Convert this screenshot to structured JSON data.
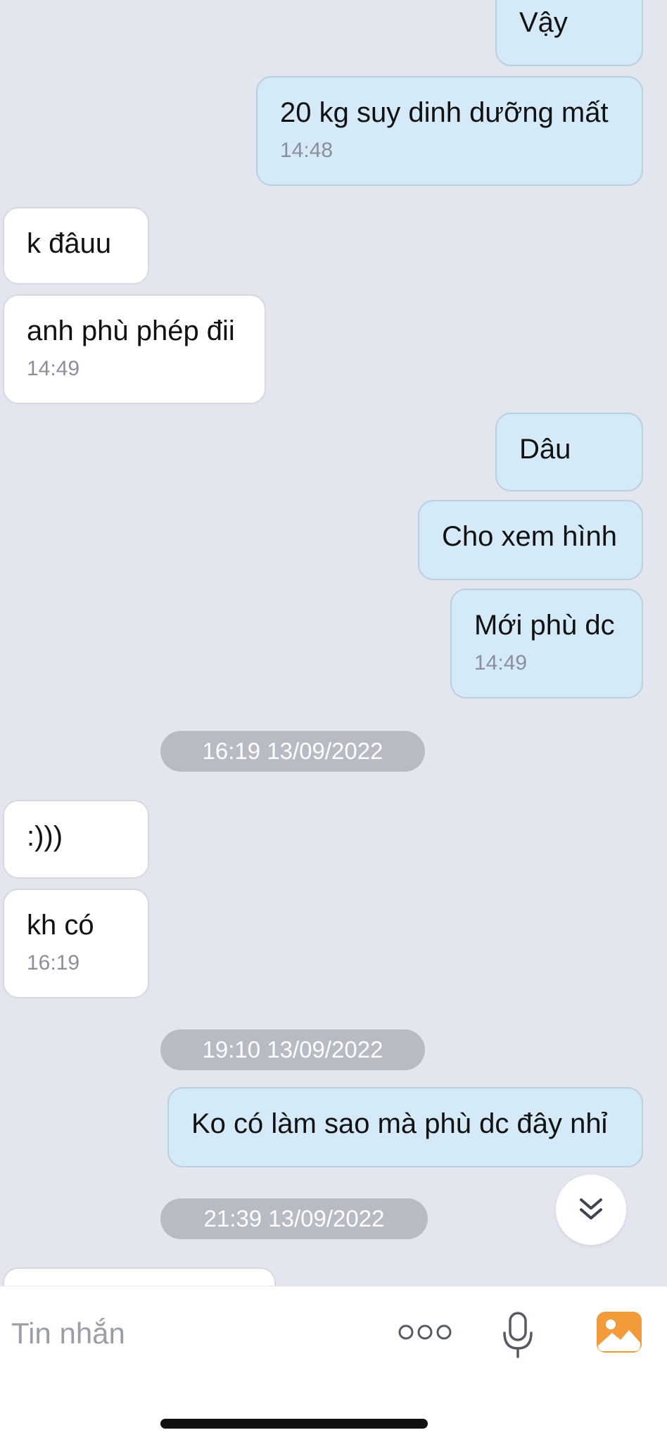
{
  "messages": [
    {
      "dir": "out",
      "text": "Vậy",
      "time": ""
    },
    {
      "dir": "out",
      "text": "20 kg suy dinh dưỡng mất",
      "time": "14:48"
    },
    {
      "dir": "in",
      "text": "k đâuu",
      "time": ""
    },
    {
      "dir": "in",
      "text": "anh phù phép đii",
      "time": "14:49"
    },
    {
      "dir": "out",
      "text": "Dâu",
      "time": ""
    },
    {
      "dir": "out",
      "text": "Cho xem hình",
      "time": ""
    },
    {
      "dir": "out",
      "text": "Mới phù dc",
      "time": "14:49"
    },
    {
      "dir": "in",
      "text": ":)))",
      "time": ""
    },
    {
      "dir": "in",
      "text": "kh có",
      "time": "16:19"
    },
    {
      "dir": "out",
      "text": "Ko có làm sao mà phù dc đây nhỉ",
      "time": ""
    },
    {
      "dir": "in",
      "text": "",
      "time": ""
    }
  ],
  "dividers": [
    "16:19 13/09/2022",
    "19:10 13/09/2022",
    "21:39 13/09/2022"
  ],
  "composer": {
    "placeholder": "Tin nhắn",
    "icons": [
      "more-icon",
      "microphone-icon",
      "photo-icon"
    ]
  },
  "colors": {
    "background": "#e3e6ef",
    "outgoing_bubble": "#d5eaf9",
    "incoming_bubble": "#ffffff",
    "divider": "#b8bbc3",
    "photo_icon": "#f39a3a"
  }
}
